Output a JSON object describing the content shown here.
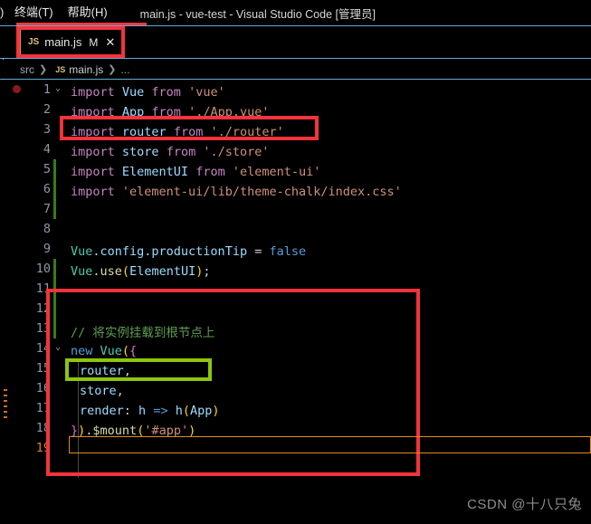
{
  "titlebar": {
    "clipped_menu": ")",
    "menus": [
      "终端(T)",
      "帮助(H)"
    ],
    "window_title": "main.js - vue-test - Visual Studio Code [管理员]",
    "underline_color": "#f4393f"
  },
  "tab": {
    "icon": "JS",
    "filename": "main.js",
    "dirty_indicator": "M",
    "close_glyph": "✕",
    "border_color": "#d99b22"
  },
  "breadcrumb": {
    "root": "src",
    "sep1": "❯",
    "file_icon": "JS",
    "file": "main.js",
    "sep2": "❯",
    "more": "..."
  },
  "editor": {
    "lines": [
      {
        "no": "1",
        "tokens": [
          {
            "t": "import ",
            "c": "t-kw"
          },
          {
            "t": "Vue ",
            "c": "t-var"
          },
          {
            "t": "from ",
            "c": "t-kw"
          },
          {
            "t": "'vue'",
            "c": "t-str"
          }
        ]
      },
      {
        "no": "2",
        "tokens": [
          {
            "t": "import ",
            "c": "t-kw"
          },
          {
            "t": "App ",
            "c": "t-var"
          },
          {
            "t": "from ",
            "c": "t-kw"
          },
          {
            "t": "'./App.vue'",
            "c": "t-str"
          }
        ]
      },
      {
        "no": "3",
        "tokens": [
          {
            "t": "import ",
            "c": "t-kw"
          },
          {
            "t": "router ",
            "c": "t-var"
          },
          {
            "t": "from ",
            "c": "t-kw"
          },
          {
            "t": "'./router'",
            "c": "t-str"
          }
        ]
      },
      {
        "no": "4",
        "tokens": [
          {
            "t": "import ",
            "c": "t-kw"
          },
          {
            "t": "store ",
            "c": "t-var"
          },
          {
            "t": "from ",
            "c": "t-kw"
          },
          {
            "t": "'./store'",
            "c": "t-str"
          }
        ]
      },
      {
        "no": "5",
        "tokens": [
          {
            "t": "import ",
            "c": "t-kw"
          },
          {
            "t": "ElementUI ",
            "c": "t-var"
          },
          {
            "t": "from ",
            "c": "t-kw"
          },
          {
            "t": "'element-ui'",
            "c": "t-str"
          }
        ]
      },
      {
        "no": "6",
        "tokens": [
          {
            "t": "import ",
            "c": "t-kw"
          },
          {
            "t": "'element-ui/lib/theme-chalk/index.css'",
            "c": "t-str"
          }
        ]
      },
      {
        "no": "7",
        "tokens": []
      },
      {
        "no": "8",
        "tokens": []
      },
      {
        "no": "9",
        "tokens": [
          {
            "t": "Vue",
            "c": "t-class"
          },
          {
            "t": ".config.productionTip ",
            "c": "t-var"
          },
          {
            "t": "= ",
            "c": "t-plain"
          },
          {
            "t": "false",
            "c": "t-blue"
          }
        ]
      },
      {
        "no": "10",
        "tokens": [
          {
            "t": "Vue",
            "c": "t-class"
          },
          {
            "t": ".",
            "c": "t-plain"
          },
          {
            "t": "use",
            "c": "t-fn"
          },
          {
            "t": "(",
            "c": "t-br1"
          },
          {
            "t": "ElementUI",
            "c": "t-var"
          },
          {
            "t": ")",
            "c": "t-br1"
          },
          {
            "t": ";",
            "c": "t-plain"
          }
        ]
      },
      {
        "no": "11",
        "tokens": []
      },
      {
        "no": "12",
        "tokens": []
      },
      {
        "no": "13",
        "tokens": [
          {
            "t": "// 将实例挂载到根节点上",
            "c": "t-com"
          }
        ]
      },
      {
        "no": "14",
        "tokens": [
          {
            "t": "new ",
            "c": "t-blue"
          },
          {
            "t": "Vue",
            "c": "t-class"
          },
          {
            "t": "(",
            "c": "t-br1"
          },
          {
            "t": "{",
            "c": "t-br2"
          }
        ]
      },
      {
        "no": "15",
        "indent": 1,
        "tokens": [
          {
            "t": "router",
            "c": "t-var"
          },
          {
            "t": ",",
            "c": "t-plain"
          }
        ]
      },
      {
        "no": "16",
        "indent": 1,
        "tokens": [
          {
            "t": "store",
            "c": "t-var"
          },
          {
            "t": ",",
            "c": "t-plain"
          }
        ]
      },
      {
        "no": "17",
        "indent": 1,
        "tokens": [
          {
            "t": "render",
            "c": "t-var"
          },
          {
            "t": ": ",
            "c": "t-plain"
          },
          {
            "t": "h ",
            "c": "t-var"
          },
          {
            "t": "=> ",
            "c": "t-blue"
          },
          {
            "t": "h",
            "c": "t-var"
          },
          {
            "t": "(",
            "c": "t-br1"
          },
          {
            "t": "App",
            "c": "t-var"
          },
          {
            "t": ")",
            "c": "t-br1"
          }
        ]
      },
      {
        "no": "18",
        "tokens": [
          {
            "t": "}",
            "c": "t-br2"
          },
          {
            "t": ")",
            "c": "t-br1"
          },
          {
            "t": ".",
            "c": "t-plain"
          },
          {
            "t": "$mount",
            "c": "t-fn"
          },
          {
            "t": "(",
            "c": "t-br1"
          },
          {
            "t": "'#app'",
            "c": "t-str"
          },
          {
            "t": ")",
            "c": "t-br1"
          }
        ]
      },
      {
        "no": "19",
        "tokens": [],
        "active": true
      }
    ]
  },
  "annotations": {
    "tab_box_color": "#f4333c",
    "import_router_box_color": "#f4333c",
    "block_box_color": "#f4333c",
    "router_prop_box_color": "#8dc50f",
    "active_line_color": "#e08a22"
  },
  "watermark": "CSDN @十八只兔"
}
